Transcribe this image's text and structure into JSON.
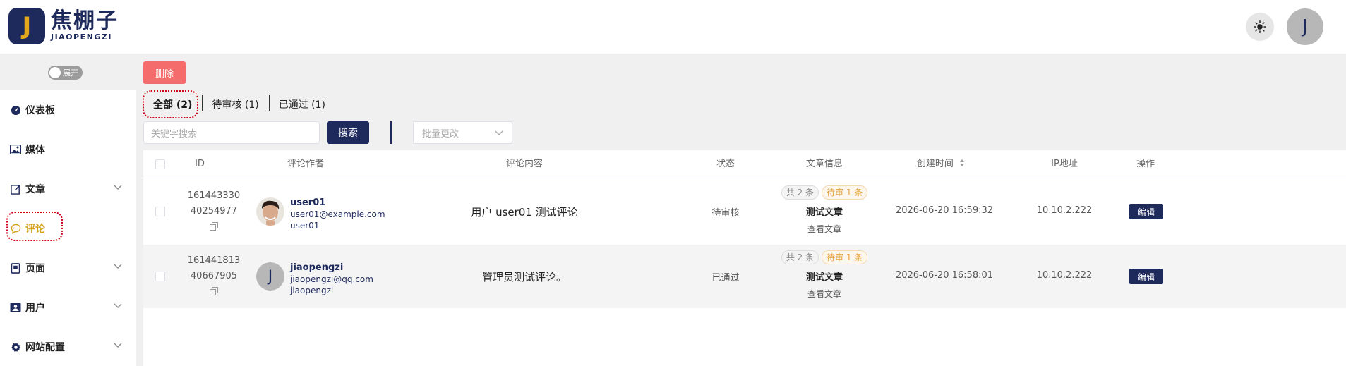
{
  "header": {
    "logo_letter": "J",
    "logo_cn": "焦棚子",
    "logo_en": "JIAOPENGZI",
    "theme_icon": "sun-icon",
    "avatar_initial": "J"
  },
  "sidebar": {
    "toggle_label": "展开",
    "items": [
      {
        "label": "仪表板",
        "icon": "dashboard-icon",
        "chevron": false
      },
      {
        "label": "媒体",
        "icon": "image-icon",
        "chevron": false
      },
      {
        "label": "文章",
        "icon": "edit-icon",
        "chevron": true
      },
      {
        "label": "评论",
        "icon": "comment-icon",
        "chevron": false,
        "active": true
      },
      {
        "label": "页面",
        "icon": "page-icon",
        "chevron": true
      },
      {
        "label": "用户",
        "icon": "user-card-icon",
        "chevron": true
      },
      {
        "label": "网站配置",
        "icon": "gear-icon",
        "chevron": true
      }
    ],
    "active_color": "#d4a017"
  },
  "toolbar": {
    "delete_label": "删除",
    "tabs": [
      {
        "label": "全部 (2)",
        "active": true
      },
      {
        "label": "待审核 (1)",
        "active": false
      },
      {
        "label": "已通过 (1)",
        "active": false
      }
    ],
    "search_placeholder": "关键字搜索",
    "search_label": "搜索",
    "batch_placeholder": "批量更改"
  },
  "table": {
    "columns": [
      "ID",
      "评论作者",
      "评论内容",
      "状态",
      "文章信息",
      "创建时间",
      "IP地址",
      "操作"
    ],
    "rows": [
      {
        "id_line1": "161443330",
        "id_line2": "40254977",
        "author_name": "user01",
        "author_email": "user01@example.com",
        "author_login": "user01",
        "avatar_type": "photo",
        "content": "用户 user01 测试评论",
        "status": "待审核",
        "total_badge": "共 2 条",
        "pending_badge": "待审 1 条",
        "article_title": "测试文章",
        "view_link": "查看文章",
        "created": "2026-06-20 16:59:32",
        "ip": "10.10.2.222",
        "edit_label": "编辑"
      },
      {
        "id_line1": "161441813",
        "id_line2": "40667905",
        "author_name": "jiaopengzi",
        "author_email": "jiaopengzi@qq.com",
        "author_login": "jiaopengzi",
        "avatar_type": "initial",
        "avatar_initial": "J",
        "content": "管理员测试评论。",
        "status": "已通过",
        "total_badge": "共 2 条",
        "pending_badge": "待审 1 条",
        "article_title": "测试文章",
        "view_link": "查看文章",
        "created": "2026-06-20 16:58:01",
        "ip": "10.10.2.222",
        "edit_label": "编辑"
      }
    ]
  },
  "colors": {
    "brand": "#1f2a5c",
    "accent": "#e3a91b",
    "danger": "#f56c6c"
  }
}
